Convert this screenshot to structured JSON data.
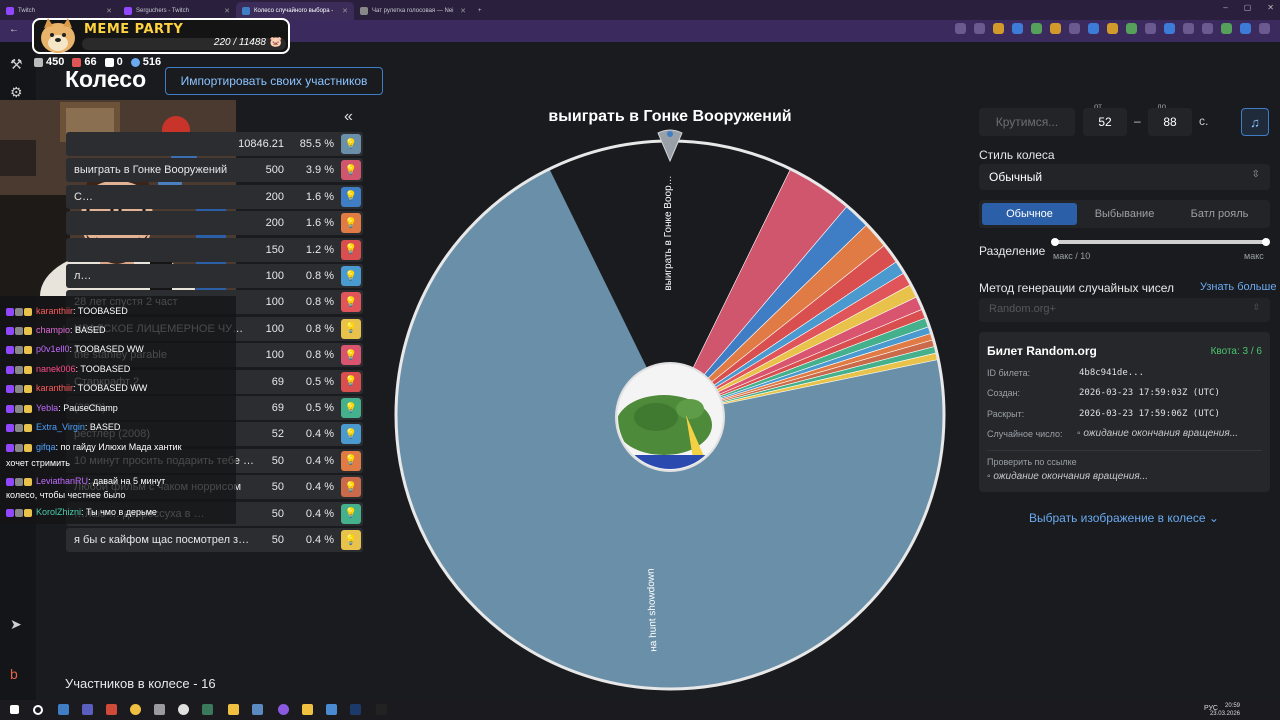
{
  "browser": {
    "tabs": [
      {
        "title": "Twitch",
        "active": false
      },
      {
        "title": "Serguchers - Twitch",
        "active": false
      },
      {
        "title": "Колесо случайного выбора -",
        "active": true
      },
      {
        "title": "Чат рулетка голосовая — Nei",
        "active": false
      }
    ]
  },
  "meme_party": {
    "title": "MEME PARTY",
    "count": "220 / 11488"
  },
  "stats": {
    "chat": "450",
    "subs": "66",
    "w": "0",
    "viewers": "516"
  },
  "page": {
    "title": "Колесо",
    "import_button": "Импортировать своих участников",
    "collapse": "«",
    "participants_count": "Участников в колесе - 16"
  },
  "participants": [
    {
      "name": "",
      "amount": "10846.21",
      "pct": "85.5 %",
      "color": "#6a8fa8"
    },
    {
      "name": "выиграть в Гонке Вооружений",
      "amount": "500",
      "pct": "3.9 %",
      "color": "#d0566e"
    },
    {
      "name": "C…",
      "amount": "200",
      "pct": "1.6 %",
      "color": "#3f7ec4"
    },
    {
      "name": "",
      "amount": "200",
      "pct": "1.6 %",
      "color": "#e07b45"
    },
    {
      "name": "",
      "amount": "150",
      "pct": "1.2 %",
      "color": "#d94f4f"
    },
    {
      "name": "л…",
      "amount": "100",
      "pct": "0.8 %",
      "color": "#4a9ad0"
    },
    {
      "name": "28 лет спустя 2 част",
      "amount": "100",
      "pct": "0.8 %",
      "color": "#e0555a"
    },
    {
      "name": "ИЗАЛСКОЕ ЛИЦЕМЕРНОЕ ЧУ…",
      "amount": "100",
      "pct": "0.8 %",
      "color": "#e8c24a"
    },
    {
      "name": "the stanley parable",
      "amount": "100",
      "pct": "0.8 %",
      "color": "#d9546e"
    },
    {
      "name": "Старкрафт 2",
      "amount": "69",
      "pct": "0.5 %",
      "color": "#d94f4f"
    },
    {
      "name": "(2022)",
      "amount": "69",
      "pct": "0.5 %",
      "color": "#45b08c"
    },
    {
      "name": "рестлер (2008)",
      "amount": "52",
      "pct": "0.4 %",
      "color": "#4a9ad0"
    },
    {
      "name": "10 минут просить подарить тебе …",
      "amount": "50",
      "pct": "0.4 %",
      "color": "#e07b45"
    },
    {
      "name": "Любой фильм с чаком норрисом",
      "amount": "50",
      "pct": "0.4 %",
      "color": "#c96b4a"
    },
    {
      "name": "…лаю … депрессуха в …",
      "amount": "50",
      "pct": "0.4 %",
      "color": "#45b08c"
    },
    {
      "name": "я бы с кайфом щас посмотрел з…",
      "amount": "50",
      "pct": "0.4 %",
      "color": "#e8c24a"
    }
  ],
  "chat": [
    {
      "user": "karanthiir",
      "text": "TOOBASED",
      "color": "#ff5c5c"
    },
    {
      "user": "champio",
      "text": "BASED",
      "color": "#e06bd6"
    },
    {
      "user": "p0v1ell0",
      "text": "TOOBASED WW",
      "color": "#c06bff"
    },
    {
      "user": "nanek006",
      "text": "TOOBASED",
      "color": "#ff4c8a"
    },
    {
      "user": "karanthiir",
      "text": "TOOBASED WW",
      "color": "#ff5c5c"
    },
    {
      "user": "Yebla",
      "text": "PauseChamp",
      "color": "#c06bff"
    },
    {
      "user": "Extra_Virgin",
      "text": "BASED",
      "color": "#4aa0ff"
    },
    {
      "user": "gifqa",
      "text": "по гайду Илюхи Мада хантик",
      "color": "#4aa0ff"
    },
    {
      "user": "",
      "text": "хочет стримить",
      "color": "#ffffff"
    },
    {
      "user": "LeviathanRU",
      "text": "давай на 5 минут",
      "color": "#c06bff"
    },
    {
      "user": "",
      "text": "колесо, чтобы честнее было",
      "color": "#ffffff"
    },
    {
      "user": "KorolZhizni",
      "text": "Ты чмо в дерьме",
      "color": "#4acfb0"
    }
  ],
  "wheel": {
    "title": "выиграть в Гонке Вооружений",
    "label_big": "на hunt showdown",
    "label_small": "выиграть в Гонке Воор…"
  },
  "controls": {
    "spin_button": "Крутимся...",
    "from_label": "от",
    "to_label": "до",
    "from_value": "52",
    "to_value": "88",
    "unit": "с.",
    "dash": "–",
    "style_label": "Стиль колеса",
    "style_value": "Обычный",
    "modes": [
      "Обычное",
      "Выбывание",
      "Батл рояль"
    ],
    "split_label": "Разделение",
    "split_min": "макс / 10",
    "split_max": "макс",
    "split_value": 1.0,
    "rng_label": "Метод генерации случайных чисел",
    "rng_link": "Узнать больше",
    "rng_value": "Random.org+"
  },
  "ticket": {
    "title": "Билет Random.org",
    "quota": "Квота: 3 / 6",
    "id_key": "ID билета:",
    "id_val": "4b8c941de...",
    "created_key": "Создан:",
    "created_val": "2026-03-23 17:59:03Z (UTC)",
    "revealed_key": "Раскрыт:",
    "revealed_val": "2026-03-23 17:59:06Z (UTC)",
    "random_key": "Случайное число:",
    "random_val": "ожидание окончания вращения...",
    "verify_key": "Проверить по ссылке",
    "verify_val": "ожидание окончания вращения..."
  },
  "select_image": "Выбрать изображение в колесе",
  "taskbar": {
    "lang": "РУС",
    "time": "20:59",
    "date": "23.03.2026"
  }
}
